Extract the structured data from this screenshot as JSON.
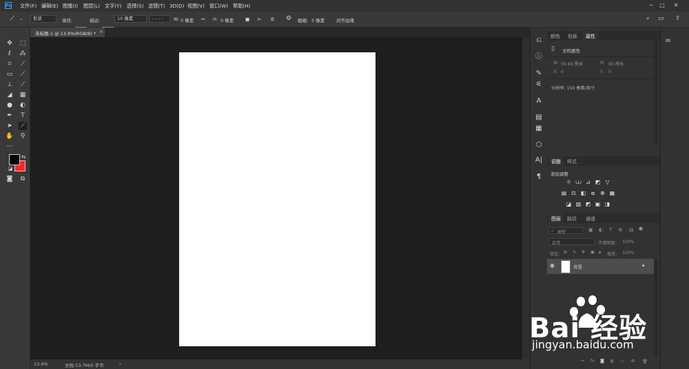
{
  "menubar": {
    "logo": "Ps",
    "items": [
      "文件(F)",
      "编辑(E)",
      "图像(I)",
      "图层(L)",
      "文字(Y)",
      "选择(S)",
      "滤镜(T)",
      "3D(D)",
      "视图(V)",
      "窗口(W)",
      "帮助(H)"
    ],
    "window_controls": [
      "─",
      "□",
      "✕"
    ]
  },
  "options": {
    "shape_mode": "形状",
    "fill_label": "填充:",
    "stroke_label": "描边:",
    "stroke_size": "10 像素",
    "w_label": "W:",
    "w_value": "0 像素",
    "h_label": "H:",
    "h_value": "0 像素",
    "weight_label": "粗细:",
    "weight_value": "5 像素",
    "align_edges_label": "对齐边缘"
  },
  "document": {
    "tab_label": "未标题-1 @ 13.9%(RGB/8) *",
    "close": "×"
  },
  "status": {
    "zoom": "13.9%",
    "doc_info": "文档:53.7M/0 字节",
    "arrow": "›"
  },
  "properties_panel": {
    "tabs": [
      "颜色",
      "色板",
      "属性"
    ],
    "active_tab": "属性",
    "section_title": "文档属性",
    "w_label": "W:",
    "w_value": "59.84 厘米",
    "h_label": "H:",
    "h_value": "90 厘米",
    "x_label": "X:",
    "x_value": "0",
    "y_label": "Y:",
    "y_value": "0",
    "resolution": "分辨率: 150 像素/英寸"
  },
  "adjustments_panel": {
    "tabs": [
      "调整",
      "样式"
    ],
    "active_tab": "调整",
    "title": "添加调整"
  },
  "layers_panel": {
    "tabs": [
      "图层",
      "路径",
      "通道"
    ],
    "active_tab": "图层",
    "filter_kind": "类型",
    "blend_mode": "正常",
    "opacity_label": "不透明度:",
    "opacity_value": "100%",
    "lock_label": "锁定:",
    "fill_label": "填充:",
    "fill_value": "100%",
    "layers": [
      {
        "name": "背景"
      }
    ]
  },
  "watermark": {
    "brand": "Bai  经验",
    "url": "jingyan.baidu.com"
  },
  "colors": {
    "foreground": "#000000",
    "background": "#ff2424",
    "accent": "#31a8ff"
  }
}
